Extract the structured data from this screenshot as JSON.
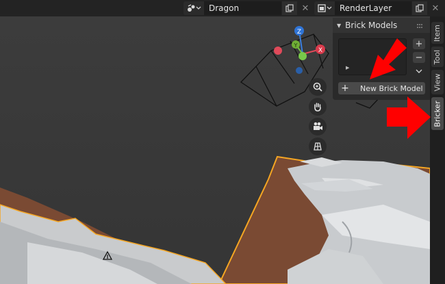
{
  "header": {
    "scene_name": "Dragon",
    "view_layer_name": "RenderLayer"
  },
  "icons": {
    "scene": "scene-icon",
    "view_layer": "render-layer-icon",
    "copy": "copy-icon",
    "close": "close-icon"
  },
  "panel": {
    "title": "Brick Models",
    "add_button": "+",
    "remove_button": "−",
    "new_model_label": "New Brick Model"
  },
  "tabs": [
    {
      "label": "Item"
    },
    {
      "label": "Tool"
    },
    {
      "label": "View"
    },
    {
      "label": "Bricker"
    }
  ],
  "gizmo": {
    "z_label": "Z",
    "y_label": "Y",
    "x_label": "X"
  },
  "colors": {
    "annotation_arrow": "#ff0000",
    "selection_outline": "#f5a623",
    "terrain": "#7a4a33"
  }
}
